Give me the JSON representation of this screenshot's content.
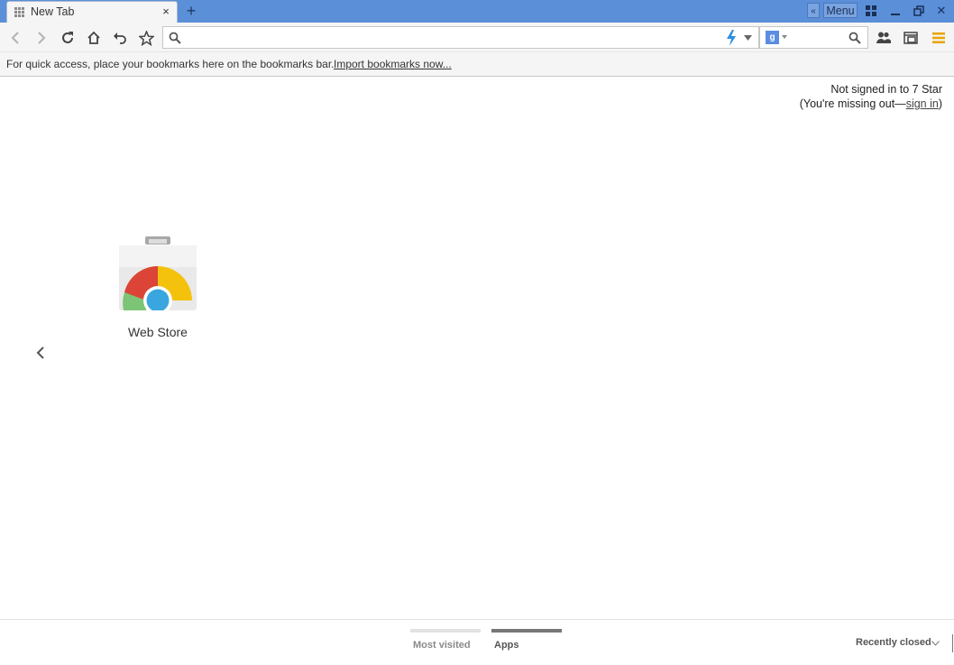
{
  "tab": {
    "title": "New Tab",
    "close": "×"
  },
  "titlebar": {
    "new_tab": "+",
    "collapse": "«",
    "menu": "Menu",
    "minimize": "–",
    "close": "✕"
  },
  "omnibox": {
    "value": "",
    "placeholder": ""
  },
  "search": {
    "engine_icon": "google-icon",
    "engine_letter": "g",
    "value": ""
  },
  "bookmarks_bar": {
    "message": "For quick access, place your bookmarks here on the bookmarks bar.",
    "import_link": "Import bookmarks now..."
  },
  "signin": {
    "line1": "Not signed in to 7 Star",
    "line2_prefix": "(You're missing out—",
    "link": "sign in",
    "line2_suffix": ")"
  },
  "apps": [
    {
      "label": "Web Store",
      "icon": "chrome-web-store-icon"
    }
  ],
  "footer": {
    "pages": [
      {
        "label": "Most visited",
        "active": false
      },
      {
        "label": "Apps",
        "active": true
      }
    ],
    "recently_closed": "Recently closed"
  },
  "colors": {
    "titlebar": "#5b8fd8",
    "toolbar": "#f5f5f5",
    "menu_icon": "#e8a400",
    "pager_active": "#777777",
    "pager_inactive": "#e2e2e2"
  }
}
